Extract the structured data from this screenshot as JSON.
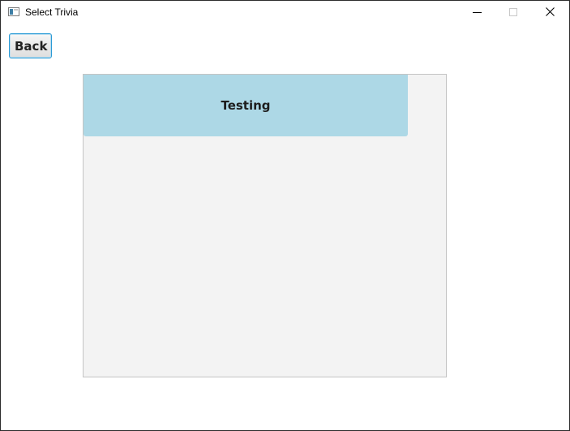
{
  "window": {
    "title": "Select Trivia",
    "controls": {
      "minimize_icon": "minimize-icon",
      "maximize_icon": "maximize-icon",
      "close_icon": "close-icon"
    }
  },
  "toolbar": {
    "back_label": "Back"
  },
  "trivia_list": {
    "items": [
      {
        "label": "Testing"
      }
    ]
  },
  "colors": {
    "item_background": "#add8e6",
    "list_background": "#f3f3f3",
    "button_focus_border": "#2a9bd6"
  }
}
